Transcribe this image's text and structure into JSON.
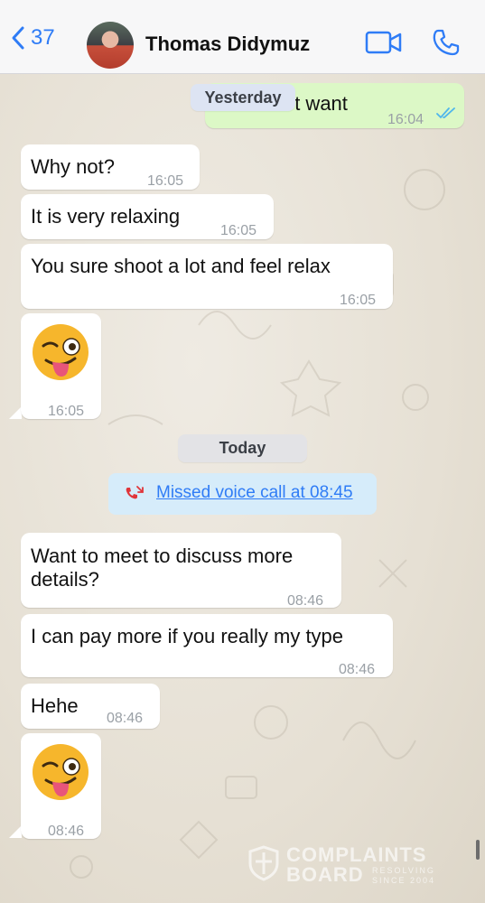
{
  "header": {
    "back_count": "37",
    "contact_name": "Thomas Didymuz",
    "icons": {
      "back": "chevron-left-icon",
      "video": "video-camera-icon",
      "call": "phone-icon"
    }
  },
  "colors": {
    "accent": "#2f7cf6",
    "outgoing_bubble": "#dcf8c6",
    "incoming_bubble": "#ffffff",
    "missed_call_bg": "#d6ecfa",
    "missed_call_icon": "#e0353a",
    "read_ticks": "#4fb6ec"
  },
  "separators": {
    "yesterday": "Yesterday",
    "today": "Today"
  },
  "messages": [
    {
      "direction": "out",
      "text": "'t want",
      "time": "16:04",
      "status": "read"
    },
    {
      "direction": "in",
      "text": "Why not?",
      "time": "16:05"
    },
    {
      "direction": "in",
      "text": "It is very relaxing",
      "time": "16:05"
    },
    {
      "direction": "in",
      "text": "You sure shoot a lot and feel relax",
      "time": "16:05"
    },
    {
      "direction": "in",
      "emoji": "winking-face-with-tongue",
      "time": "16:05"
    },
    {
      "direction": "in",
      "text_lines": [
        "Want to meet to discuss more",
        "details?"
      ],
      "time": "08:46"
    },
    {
      "direction": "in",
      "text": "I can pay more if you really my type",
      "time": "08:46"
    },
    {
      "direction": "in",
      "text": "Hehe",
      "time": "08:46"
    },
    {
      "direction": "in",
      "emoji": "winking-face-with-tongue",
      "time": "08:46"
    }
  ],
  "missed_call": {
    "label": "Missed voice call at 08:45",
    "icon": "missed-call-icon"
  },
  "watermark": {
    "line1": "COMPLAINTS",
    "line2": "BOARD",
    "tagline1": "RESOLVING",
    "tagline2": "SINCE 2004"
  }
}
